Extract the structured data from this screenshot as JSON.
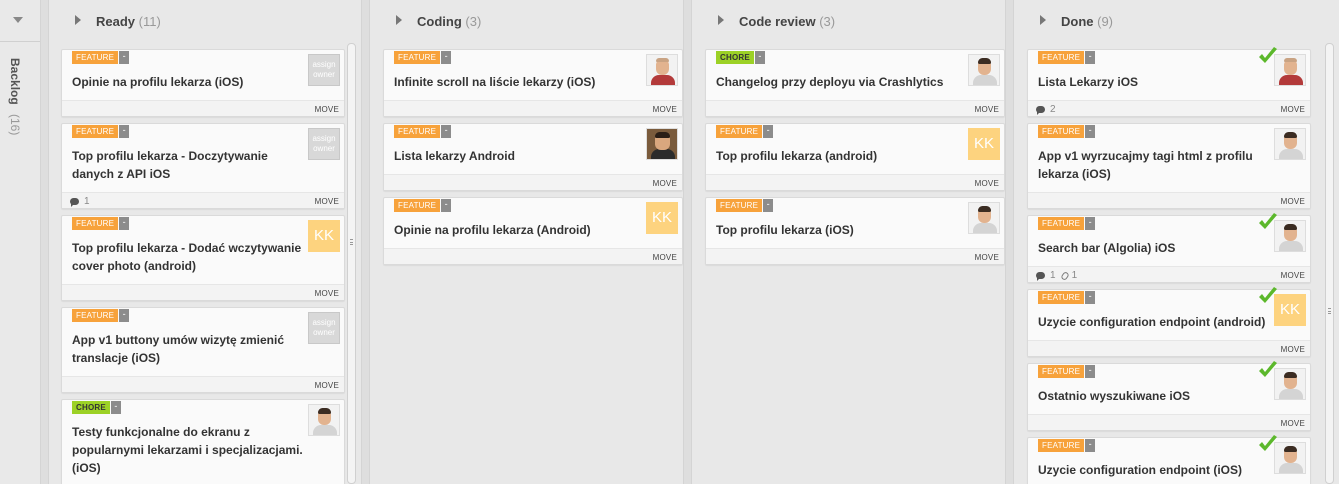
{
  "backlog": {
    "label": "Backlog",
    "count": "(16)"
  },
  "columns": [
    {
      "title": "Ready",
      "count": "(11)",
      "cards": [
        {
          "tag": "FEATURE",
          "title": "Opinie na profilu lekarza (iOS)",
          "owner": "assign owner",
          "move": "MOVE"
        },
        {
          "tag": "FEATURE",
          "title": "Top profilu lekarza - Doczytywanie danych z API iOS",
          "owner": "assign owner",
          "comments": "1",
          "move": "MOVE"
        },
        {
          "tag": "FEATURE",
          "title": "Top profilu lekarza - Dodać wczytywanie cover photo (android)",
          "owner": "KK",
          "move": "MOVE"
        },
        {
          "tag": "FEATURE",
          "title": "App v1 buttony umów wizytę zmienić translacje (iOS)",
          "owner": "assign owner",
          "move": "MOVE"
        },
        {
          "tag": "CHORE",
          "title": "Testy funkcjonalne do ekranu z popularnymi lekarzami i specjalizacjami. (iOS)"
        }
      ]
    },
    {
      "title": "Coding",
      "count": "(3)",
      "cards": [
        {
          "tag": "FEATURE",
          "title": "Infinite scroll na liście lekarzy (iOS)",
          "move": "MOVE"
        },
        {
          "tag": "FEATURE",
          "title": "Lista lekarzy Android",
          "move": "MOVE"
        },
        {
          "tag": "FEATURE",
          "title": "Opinie na profilu lekarza (Android)",
          "owner": "KK",
          "move": "MOVE"
        }
      ]
    },
    {
      "title": "Code review",
      "count": "(3)",
      "cards": [
        {
          "tag": "CHORE",
          "title": "Changelog przy deployu via Crashlytics",
          "move": "MOVE"
        },
        {
          "tag": "FEATURE",
          "title": "Top profilu lekarza (android)",
          "owner": "KK",
          "move": "MOVE"
        },
        {
          "tag": "FEATURE",
          "title": "Top profilu lekarza (iOS)",
          "move": "MOVE"
        }
      ]
    },
    {
      "title": "Done",
      "count": "(9)",
      "cards": [
        {
          "tag": "FEATURE",
          "title": "Lista Lekarzy iOS",
          "comments": "2",
          "move": "MOVE"
        },
        {
          "tag": "FEATURE",
          "title": "App v1 wyrzucajmy tagi html z profilu lekarza (iOS)",
          "move": "MOVE"
        },
        {
          "tag": "FEATURE",
          "title": "Search bar (Algolia) iOS",
          "comments": "1",
          "attachments": "1",
          "move": "MOVE"
        },
        {
          "tag": "FEATURE",
          "title": "Uzycie configuration endpoint (android)",
          "owner": "KK",
          "move": "MOVE"
        },
        {
          "tag": "FEATURE",
          "title": "Ostatnio wyszukiwane iOS",
          "move": "MOVE"
        },
        {
          "tag": "FEATURE",
          "title": "Uzycie configuration endpoint (iOS)"
        }
      ]
    }
  ],
  "tag_menu_glyph": "-",
  "colors": {
    "feature": "#f7a23b",
    "chore": "#9cd126",
    "done_check": "#5cb82c",
    "owner_initials_bg": "#fdd37f"
  },
  "icons": [
    "collapse-triangle-icon",
    "expand-triangle-icon",
    "comment-icon",
    "attachment-icon",
    "done-check-icon",
    "avatar-icon"
  ]
}
